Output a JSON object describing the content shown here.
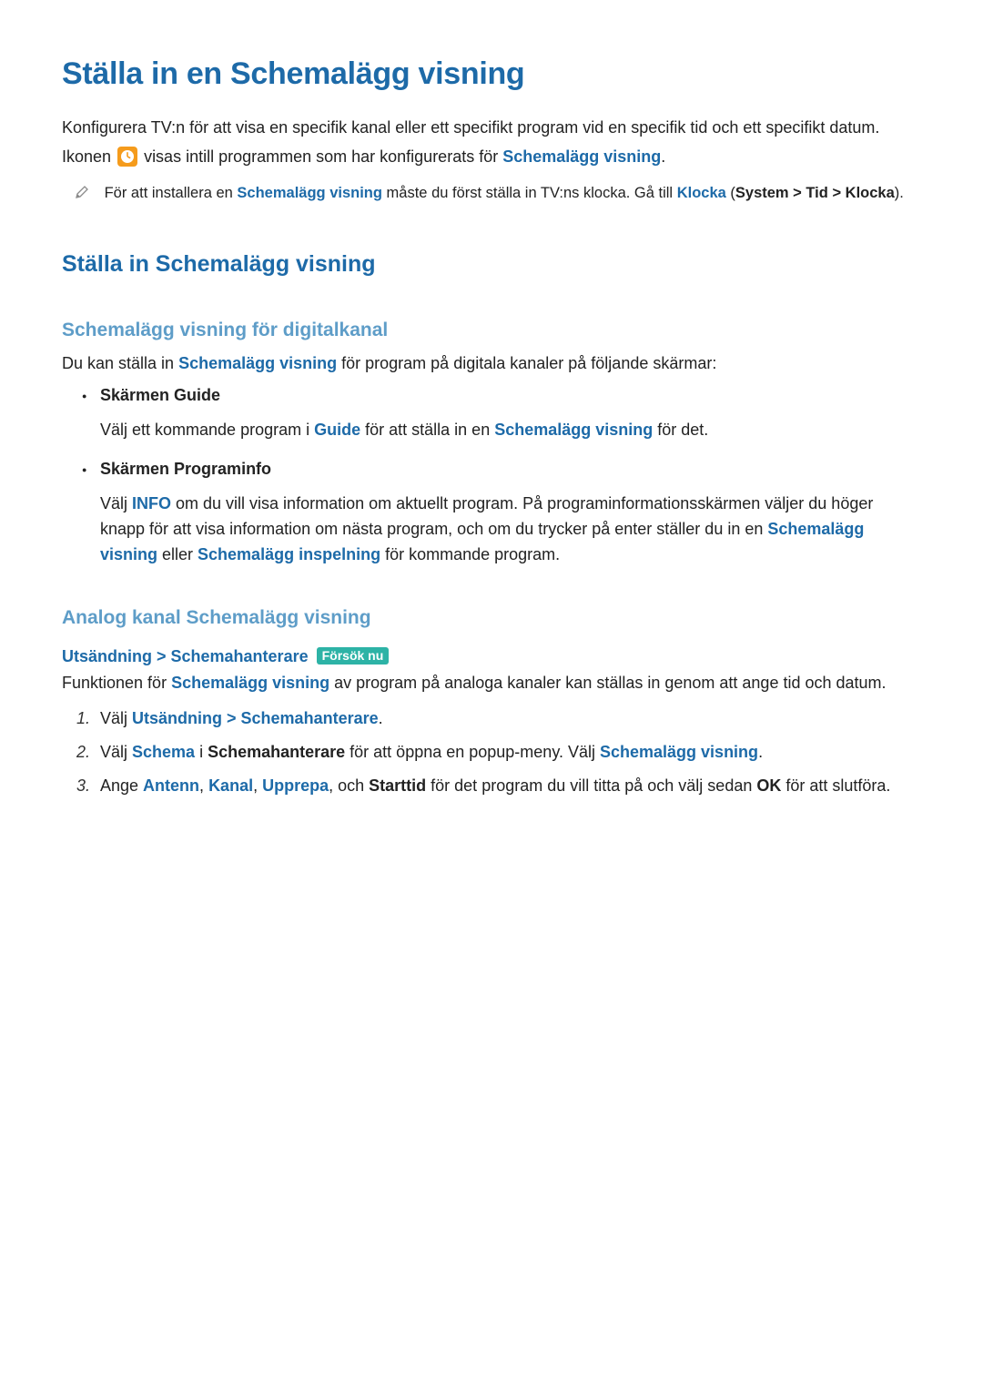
{
  "title": "Ställa in en Schemalägg visning",
  "intro": {
    "para1": "Konfigurera TV:n för att visa en specifik kanal eller ett specifikt program vid en specifik tid och ett specifikt datum.",
    "para2_pre": "Ikonen ",
    "para2_post": " visas intill programmen som har konfigurerats för ",
    "para2_term": "Schemalägg visning",
    "para2_end": "."
  },
  "note": {
    "pre": "För att installera en ",
    "term": "Schemalägg visning",
    "mid": " måste du först ställa in TV:ns klocka. Gå till ",
    "klocka": "Klocka",
    "open": " (",
    "system": "System",
    "gt1": " > ",
    "tid": "Tid",
    "gt2": " > ",
    "klocka2": "Klocka",
    "close": ")."
  },
  "section2_title": "Ställa in Schemalägg visning",
  "digital": {
    "title": "Schemalägg visning för digitalkanal",
    "lead_pre": "Du kan ställa in ",
    "lead_term": "Schemalägg visning",
    "lead_post": " för program på digitala kanaler på följande skärmar:",
    "items": [
      {
        "title": "Skärmen Guide",
        "body_pre": "Välj ett kommande program i ",
        "body_guide": "Guide",
        "body_mid": " för att ställa in en ",
        "body_term": "Schemalägg visning",
        "body_post": " för det."
      },
      {
        "title": "Skärmen Programinfo",
        "body_pre": "Välj ",
        "body_info": "INFO",
        "body_mid": " om du vill visa information om aktuellt program. På programinformationsskärmen väljer du höger knapp för att visa information om nästa program, och om du trycker på enter ställer du in en ",
        "body_term1": "Schemalägg visning",
        "body_or": " eller ",
        "body_term2": "Schemalägg inspelning",
        "body_post": " för kommande program."
      }
    ]
  },
  "analog": {
    "title": "Analog kanal Schemalägg visning",
    "path_uts": "Utsändning",
    "path_gt": " > ",
    "path_schema": "Schemahanterare",
    "badge": "Försök nu",
    "lead_pre": "Funktionen för ",
    "lead_term": "Schemalägg visning",
    "lead_post": " av program på analoga kanaler kan ställas in genom att ange tid och datum.",
    "steps": [
      {
        "pre": "Välj ",
        "t1": "Utsändning",
        "gt": " > ",
        "t2": "Schemahanterare",
        "post": "."
      },
      {
        "pre": "Välj ",
        "t1": "Schema",
        "mid": " i ",
        "t2": "Schemahanterare",
        "post": " för att öppna en popup-meny. Välj ",
        "t3": "Schemalägg visning",
        "end": "."
      },
      {
        "pre": "Ange ",
        "t1": "Antenn",
        "c1": ", ",
        "t2": "Kanal",
        "c2": ", ",
        "t3": "Upprepa",
        "c3": ", och ",
        "t4": "Starttid",
        "mid": " för det program du vill titta på och välj sedan ",
        "t5": "OK",
        "post": " för att slutföra."
      }
    ]
  }
}
